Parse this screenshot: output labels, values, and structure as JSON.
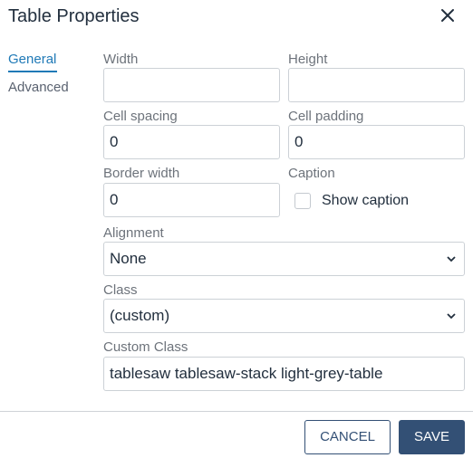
{
  "dialog": {
    "title": "Table Properties",
    "close_icon": "close-icon"
  },
  "tabs": [
    {
      "label": "General",
      "active": true
    },
    {
      "label": "Advanced",
      "active": false
    }
  ],
  "fields": {
    "width": {
      "label": "Width",
      "value": ""
    },
    "height": {
      "label": "Height",
      "value": ""
    },
    "cell_spacing": {
      "label": "Cell spacing",
      "value": "0"
    },
    "cell_padding": {
      "label": "Cell padding",
      "value": "0"
    },
    "border_width": {
      "label": "Border width",
      "value": "0"
    },
    "caption": {
      "label": "Caption",
      "checkbox_label": "Show caption",
      "checked": false
    },
    "alignment": {
      "label": "Alignment",
      "selected": "None"
    },
    "class": {
      "label": "Class",
      "selected": "(custom)"
    },
    "custom_class": {
      "label": "Custom Class",
      "value": "tablesaw tablesaw-stack light-grey-table"
    }
  },
  "footer": {
    "cancel_label": "CANCEL",
    "save_label": "SAVE"
  },
  "colors": {
    "accent": "#207ab7",
    "primary_button": "#335075",
    "text": "#222f3e",
    "label": "#6d737b",
    "border": "#ccd1d6"
  }
}
